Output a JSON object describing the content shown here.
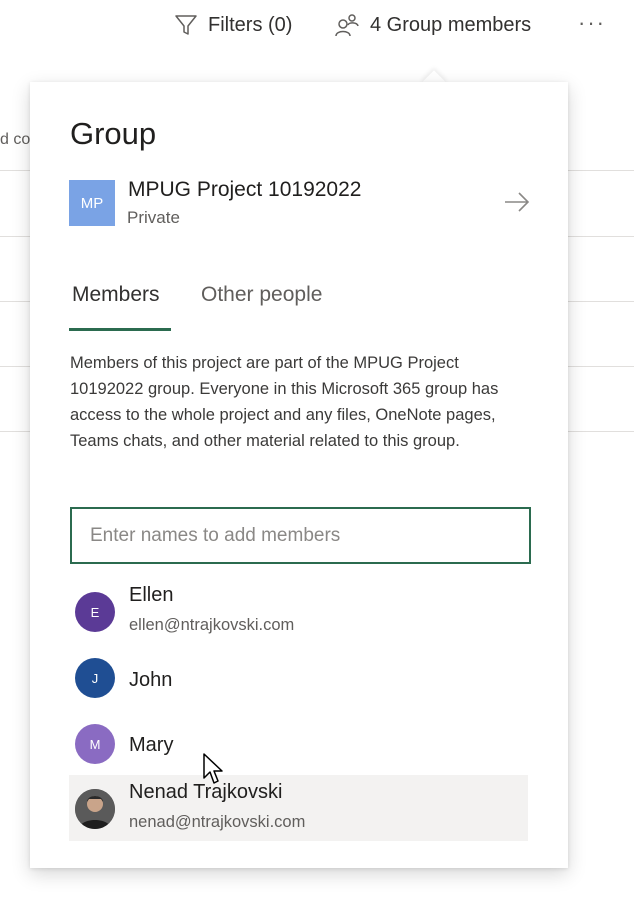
{
  "toolbar": {
    "filters_label": "Filters (0)",
    "members_label": "4 Group members",
    "more_label": "···"
  },
  "background": {
    "cut_text": "d co"
  },
  "panel": {
    "title": "Group",
    "group": {
      "avatar_initials": "MP",
      "avatar_color": "#7aa3e5",
      "name": "MPUG Project 10192022",
      "privacy": "Private"
    },
    "tabs": [
      {
        "label": "Members",
        "selected": true
      },
      {
        "label": "Other people",
        "selected": false
      }
    ],
    "description": "Members of this project are part of the MPUG Project 10192022 group. Everyone in this Microsoft 365 group has access to the whole project and any files, OneNote pages, Teams chats, and other material related to this group.",
    "add_members_placeholder": "Enter names to add members",
    "members": [
      {
        "initial": "E",
        "name": "Ellen",
        "email": "ellen@ntrajkovski.com",
        "color": "#5b3a96"
      },
      {
        "initial": "J",
        "name": "John",
        "email": "",
        "color": "#1f4e93"
      },
      {
        "initial": "M",
        "name": "Mary",
        "email": "",
        "color": "#8a6bc2"
      },
      {
        "initial": "",
        "name": "Nenad Trajkovski",
        "email": "nenad@ntrajkovski.com",
        "color": "#4a4a4a"
      }
    ]
  },
  "colors": {
    "accent": "#2b6b4f"
  }
}
